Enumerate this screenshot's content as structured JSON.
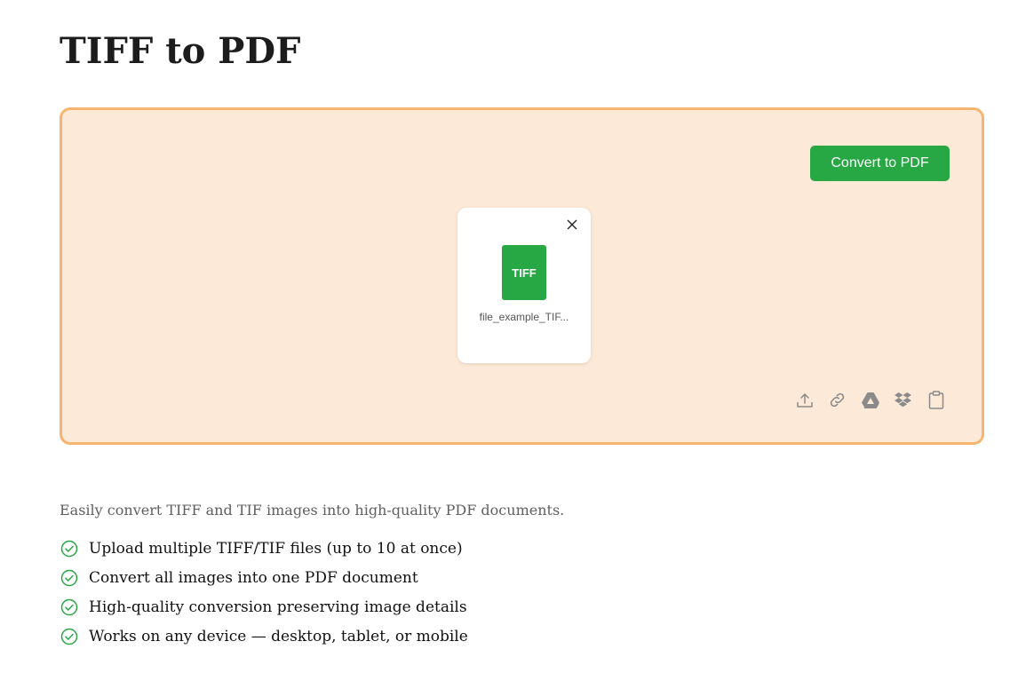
{
  "page": {
    "title": "TIFF to PDF"
  },
  "dropzone": {
    "convert_label": "Convert to PDF",
    "file": {
      "badge_label": "TIFF",
      "name": "file_example_TIF..."
    },
    "sources": [
      {
        "icon": "upload-icon"
      },
      {
        "icon": "link-icon"
      },
      {
        "icon": "google-drive-icon"
      },
      {
        "icon": "dropbox-icon"
      },
      {
        "icon": "clipboard-icon"
      }
    ]
  },
  "description": {
    "intro": "Easily convert TIFF and TIF images into high-quality PDF documents.",
    "features": [
      "Upload multiple TIFF/TIF files (up to 10 at once)",
      "Convert all images into one PDF document",
      "High-quality conversion preserving image details",
      "Works on any device — desktop, tablet, or mobile"
    ]
  },
  "colors": {
    "accent_green": "#28a745",
    "dropzone_bg": "#fde9d7",
    "dropzone_border": "#f7b56f"
  }
}
